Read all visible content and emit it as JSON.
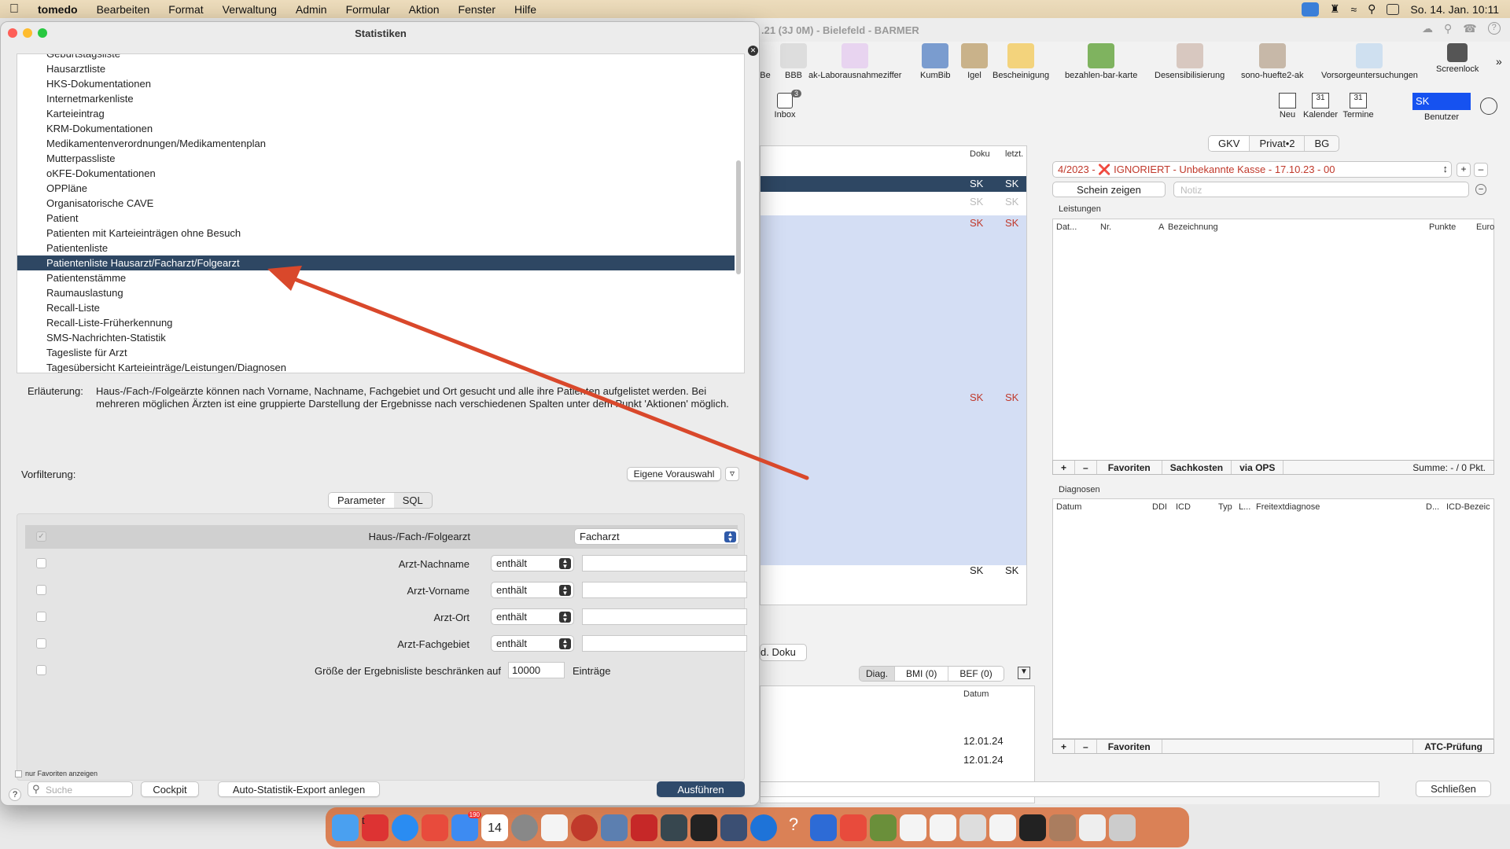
{
  "menubar": {
    "app": "tomedo",
    "items": [
      "Bearbeiten",
      "Format",
      "Verwaltung",
      "Admin",
      "Formular",
      "Aktion",
      "Fenster",
      "Hilfe"
    ],
    "clock": "So. 14. Jan.  10:11"
  },
  "background_window": {
    "title": ".21 (3J 0M) - Bielefeld  - BARMER",
    "toolbar": [
      "Be",
      "BBB",
      "ak-Laborausnahmeziffer",
      "KumBib",
      "Igel",
      "Bescheinigung",
      "bezahlen-bar-karte",
      "Desensibilisierung",
      "sono-huefte2-ak",
      "Vorsorgeuntersuchungen",
      "Screenlock"
    ],
    "inbox": {
      "label": "Inbox",
      "badge": "3"
    },
    "right_tools": [
      "Neu",
      "Kalender",
      "Termine"
    ],
    "calendar_day": "31",
    "user_badge": "SK",
    "user_label": "Benutzer",
    "doc_columns": [
      "Doku",
      "letzt."
    ],
    "sk_rows": [
      [
        "SK",
        "SK"
      ],
      [
        "SK",
        "SK"
      ],
      [
        "SK",
        "SK"
      ],
      [
        "SK",
        "SK"
      ],
      [
        "SK",
        "SK"
      ]
    ],
    "tabs": [
      "GKV",
      "Privat•2",
      "BG"
    ],
    "schein": "4/2023 -  ❌ IGNORIERT - Unbekannte Kasse - 17.10.23 - 00",
    "schein_zeigen": "Schein zeigen",
    "notiz_placeholder": "Notiz",
    "leistungen": {
      "title": "Leistungen",
      "columns": [
        "Dat...",
        "Nr.",
        "A",
        "Bezeichnung",
        "Punkte",
        "Euro"
      ],
      "buttons": [
        "Favoriten",
        "Sachkosten",
        "via OPS"
      ],
      "summe": "Summe: - / 0 Pkt."
    },
    "diagnosen": {
      "title": "Diagnosen",
      "columns": [
        "Datum",
        "DDI",
        "ICD",
        "Typ",
        "L...",
        "Freitextdiagnose",
        "D...",
        "ICD-Bezeic"
      ],
      "buttons": [
        "Favoriten"
      ],
      "atc": "ATC-Prüfung"
    },
    "bottom_tabs": [
      "d. Doku"
    ],
    "diag_tabs": [
      "Diag.",
      "BMI (0)",
      "BEF (0)"
    ],
    "datum_header": "Datum",
    "dates": [
      "12.01.24",
      "12.01.24"
    ],
    "close_btn": "Schließen"
  },
  "dialog": {
    "title": "Statistiken",
    "list": [
      "Geburtstagsliste",
      "Hausarztliste",
      "HKS-Dokumentationen",
      "Internetmarkenliste",
      "Karteieintrag",
      "KRM-Dokumentationen",
      "Medikamentenverordnungen/Medikamentenplan",
      "Mutterpassliste",
      "oKFE-Dokumentationen",
      "OPPläne",
      "Organisatorische CAVE",
      "Patient",
      "Patienten mit Karteieinträgen ohne Besuch",
      "Patientenliste",
      "Patientenliste Hausarzt/Facharzt/Folgearzt",
      "Patientenstämme",
      "Raumauslastung",
      "Recall-Liste",
      "Recall-Liste-Früherkennung",
      "SMS-Nachrichten-Statistik",
      "Tagesliste für Arzt",
      "Tagesübersicht Karteieinträge/Leistungen/Diagnosen"
    ],
    "selected_index": 14,
    "erlaeuterung_label": "Erläuterung:",
    "erlaeuterung_text": "Haus-/Fach-/Folgeärzte können nach Vorname, Nachname, Fachgebiet und Ort gesucht und alle ihre Patienten aufgelistet werden. Bei mehreren möglichen Ärzten ist eine gruppierte Darstellung der Ergebnisse nach verschiedenen Spalten unter dem Punkt 'Aktionen' möglich.",
    "vorfilterung": "Vorfilterung:",
    "eigene_vorauswahl": "Eigene Vorauswahl",
    "tabs": [
      "Parameter",
      "SQL"
    ],
    "params": [
      {
        "label": "Haus-/Fach-/Folgearzt",
        "op": "Facharzt",
        "checked": true
      },
      {
        "label": "Arzt-Nachname",
        "op": "enthält",
        "checked": false
      },
      {
        "label": "Arzt-Vorname",
        "op": "enthält",
        "checked": false
      },
      {
        "label": "Arzt-Ort",
        "op": "enthält",
        "checked": false
      },
      {
        "label": "Arzt-Fachgebiet",
        "op": "enthält",
        "checked": false
      }
    ],
    "limit_label": "Größe der Ergebnisliste beschränken auf",
    "limit_value": "10000",
    "limit_unit": "Einträge",
    "nur_favoriten": "nur Favoriten anzeigen",
    "search_placeholder": "Suche",
    "cockpit": "Cockpit",
    "auto_export": "Auto-Statistik-Export anlegen",
    "run": "Ausführen",
    "help": "?"
  },
  "colors": {
    "selection": "#2e4763",
    "accent": "#2f5aa9",
    "arrow": "#d9482b",
    "sk_red": "#c0392b",
    "dock": "#d76e3c"
  },
  "dock": {
    "calendar_day": "14",
    "mail_badge": "190"
  }
}
